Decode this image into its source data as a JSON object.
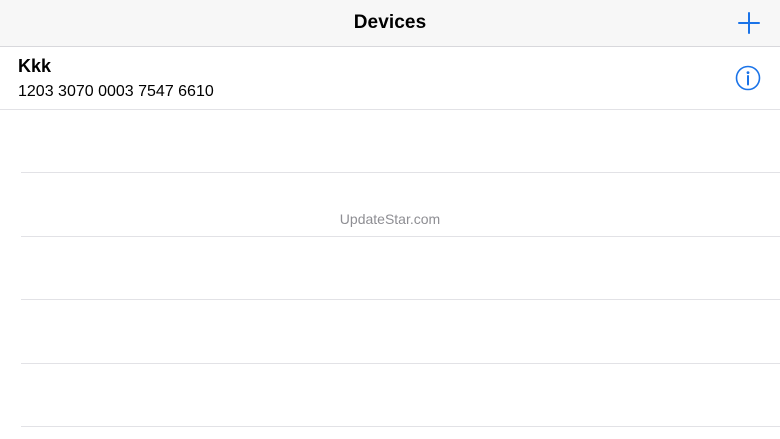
{
  "header": {
    "title": "Devices",
    "add_icon": "plus-icon"
  },
  "devices": [
    {
      "name": "Kkk",
      "serial": "1203 3070 0003 7547 6610",
      "info_icon": "info-circle-icon"
    }
  ],
  "watermark": "UpdateStar.com",
  "colors": {
    "accent": "#1a73e8",
    "nav_background": "#f7f7f7",
    "separator": "#e2e2e6",
    "watermark": "#8e8e93"
  }
}
